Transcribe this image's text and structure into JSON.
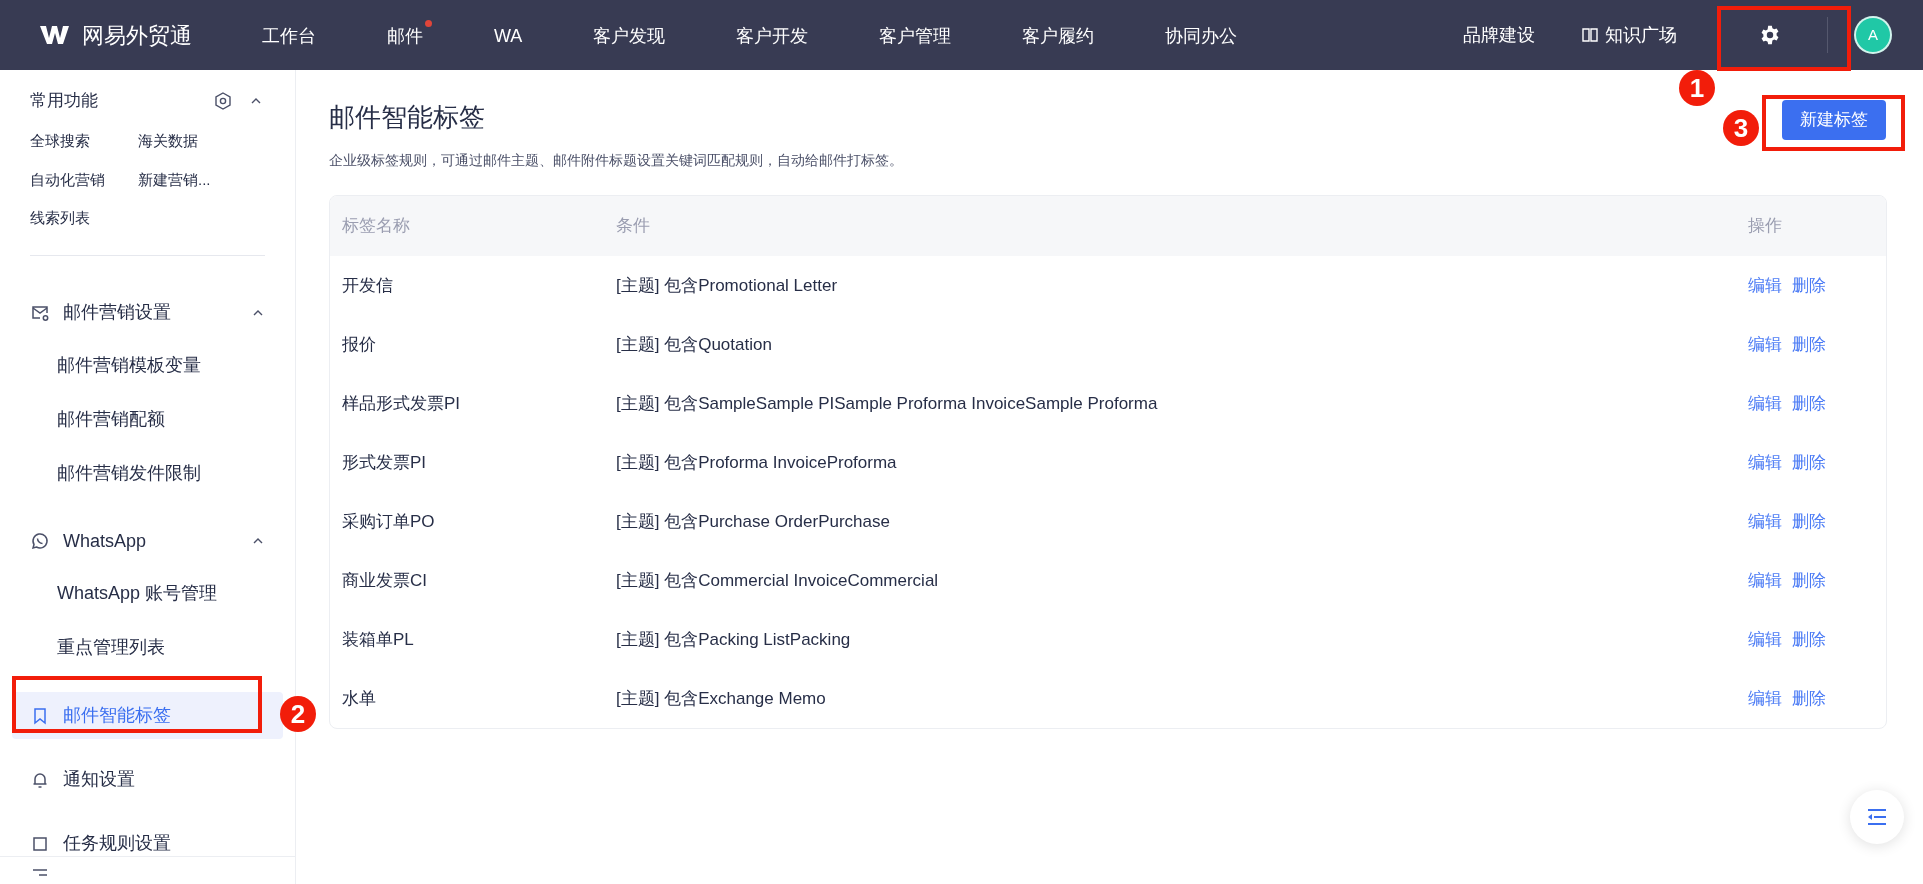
{
  "nav": {
    "logo": "网易外贸通",
    "items": [
      {
        "label": "工作台",
        "badge": false
      },
      {
        "label": "邮件",
        "badge": true
      },
      {
        "label": "WA",
        "badge": false
      },
      {
        "label": "客户发现",
        "badge": false
      },
      {
        "label": "客户开发",
        "badge": false
      },
      {
        "label": "客户管理",
        "badge": false
      },
      {
        "label": "客户履约",
        "badge": false
      },
      {
        "label": "协同办公",
        "badge": false
      }
    ],
    "right_items": [
      {
        "label": "品牌建设",
        "kind": "text"
      },
      {
        "label": "知识广场",
        "kind": "book"
      }
    ],
    "avatar": "A"
  },
  "sidebar": {
    "quick": {
      "title": "常用功能",
      "expanded": true,
      "items": [
        "全球搜索",
        "海关数据",
        "自动化营销",
        "新建营销...",
        "线索列表"
      ]
    },
    "menu": [
      {
        "kind": "group",
        "label": "邮件营销设置",
        "expanded": true,
        "children": [
          {
            "label": "邮件营销模板变量",
            "selected": false
          },
          {
            "label": "邮件营销配额",
            "selected": false
          },
          {
            "label": "邮件营销发件限制",
            "selected": false
          }
        ]
      },
      {
        "kind": "group",
        "label": "WhatsApp",
        "expanded": true,
        "children": [
          {
            "label": "WhatsApp 账号管理",
            "selected": false
          },
          {
            "label": "重点管理列表",
            "selected": false
          }
        ]
      },
      {
        "kind": "item",
        "label": "邮件智能标签",
        "selected": true
      },
      {
        "kind": "item",
        "label": "通知设置",
        "selected": false
      },
      {
        "kind": "item",
        "label": "任务规则设置",
        "selected": false
      }
    ]
  },
  "page": {
    "title": "邮件智能标签",
    "description": "企业级标签规则，可通过邮件主题、邮件附件标题设置关键词匹配规则，自动给邮件打标签。",
    "new_button": "新建标签",
    "table": {
      "columns": [
        "标签名称",
        "条件",
        "操作"
      ],
      "rows": [
        {
          "name": "开发信",
          "condition": "[主题] 包含Promotional Letter",
          "actions": [
            "编辑",
            "删除"
          ]
        },
        {
          "name": "报价",
          "condition": "[主题] 包含Quotation",
          "actions": [
            "编辑",
            "删除"
          ]
        },
        {
          "name": "样品形式发票PI",
          "condition": "[主题] 包含SampleSample PISample Proforma InvoiceSample Proforma",
          "actions": [
            "编辑",
            "删除"
          ]
        },
        {
          "name": "形式发票PI",
          "condition": "[主题] 包含Proforma InvoiceProforma",
          "actions": [
            "编辑",
            "删除"
          ]
        },
        {
          "name": "采购订单PO",
          "condition": "[主题] 包含Purchase OrderPurchase",
          "actions": [
            "编辑",
            "删除"
          ]
        },
        {
          "name": "商业发票CI",
          "condition": "[主题] 包含Commercial InvoiceCommercial",
          "actions": [
            "编辑",
            "删除"
          ]
        },
        {
          "name": "装箱单PL",
          "condition": "[主题] 包含Packing ListPacking",
          "actions": [
            "编辑",
            "删除"
          ]
        },
        {
          "name": "水单",
          "condition": "[主题] 包含Exchange Memo",
          "actions": [
            "编辑",
            "删除"
          ]
        }
      ]
    }
  },
  "annotations": [
    {
      "number": "1"
    },
    {
      "number": "2"
    },
    {
      "number": "3"
    }
  ]
}
